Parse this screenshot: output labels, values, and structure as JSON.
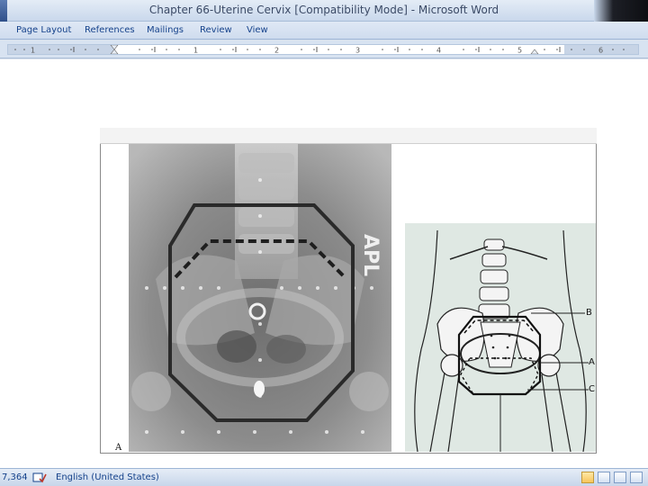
{
  "window": {
    "title": "Chapter 66-Uterine Cervix [Compatibility Mode] - Microsoft Word"
  },
  "ribbon": {
    "tabs": [
      "Page Layout",
      "References",
      "Mailings",
      "Review",
      "View"
    ]
  },
  "ruler": {
    "numbers": [
      "1",
      "1",
      "2",
      "3",
      "4",
      "5",
      "6"
    ]
  },
  "figure": {
    "panel_letter": "A",
    "xray_side_text": "APL",
    "diagram_labels": [
      "B",
      "A",
      "C"
    ]
  },
  "statusbar": {
    "word_count": "7,364",
    "language": "English (United States)"
  },
  "icons": [
    "proofing-icon",
    "print-layout-view-icon",
    "full-screen-reading-icon",
    "web-layout-view-icon",
    "outline-view-icon"
  ]
}
